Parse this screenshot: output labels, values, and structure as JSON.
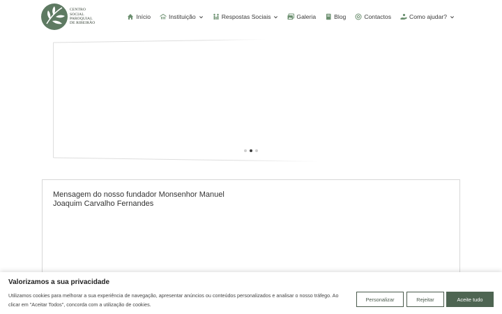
{
  "logo": {
    "lines": [
      "CENTRO",
      "SOCIAL",
      "PAROQUIAL",
      "DE RIBEIRÃO"
    ]
  },
  "nav": {
    "items": [
      {
        "label": "Início",
        "icon": "home-icon",
        "dropdown": false
      },
      {
        "label": "Instituição",
        "icon": "institution-icon",
        "dropdown": true
      },
      {
        "label": "Respostas Sociais",
        "icon": "people-icon",
        "dropdown": true
      },
      {
        "label": "Galeria",
        "icon": "gallery-icon",
        "dropdown": false
      },
      {
        "label": "Blog",
        "icon": "book-icon",
        "dropdown": false
      },
      {
        "label": "Contactos",
        "icon": "at-icon",
        "dropdown": false
      },
      {
        "label": "Como ajudar?",
        "icon": "helping-hand-icon",
        "dropdown": true
      }
    ],
    "icon_color": "#6b8f6f"
  },
  "slider": {
    "slide_count": 3,
    "active_index": 1
  },
  "message": {
    "title": "Mensagem do nosso fundador Monsenhor Manuel Joaquim Carvalho Fernandes"
  },
  "cookie_banner": {
    "title": "Valorizamos a sua privacidade",
    "text": "Utilizamos cookies para melhorar a sua experiência de navegação, apresentar anúncios ou conteúdos personalizados e analisar o nosso tráfego. Ao clicar em \"Aceitar Todos\", concorda com a utilização de cookies.",
    "buttons": {
      "customize": "Personalizar",
      "reject": "Rejeitar",
      "accept": "Aceite tudo"
    },
    "accent_color": "#4e6552"
  }
}
